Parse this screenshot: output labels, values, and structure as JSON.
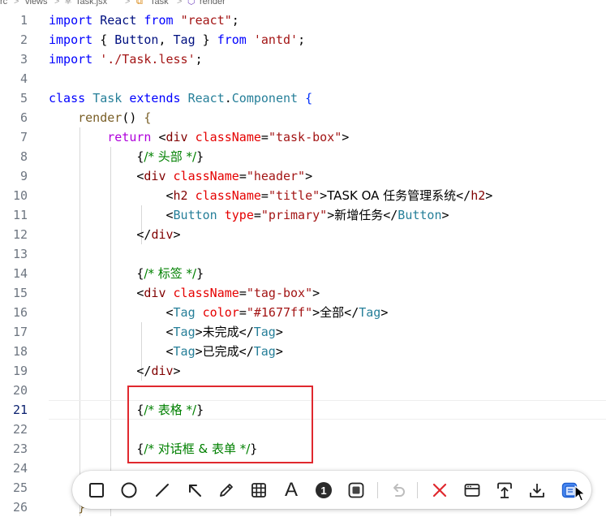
{
  "breadcrumb": {
    "segments": [
      "rc",
      "views",
      "Task.jsx",
      "Task",
      "render"
    ],
    "separator": ">"
  },
  "editor": {
    "current_line": 21,
    "line_numbers": [
      "1",
      "2",
      "3",
      "4",
      "5",
      "6",
      "7",
      "8",
      "9",
      "10",
      "11",
      "12",
      "13",
      "14",
      "15",
      "16",
      "17",
      "18",
      "19",
      "20",
      "21",
      "22",
      "23",
      "24",
      "25",
      "26"
    ],
    "lines": [
      [
        [
          "kw",
          "import"
        ],
        [
          "txt",
          " "
        ],
        [
          "var",
          "React"
        ],
        [
          "txt",
          " "
        ],
        [
          "kw",
          "from"
        ],
        [
          "txt",
          " "
        ],
        [
          "str",
          "\"react\""
        ],
        [
          "txt",
          ";"
        ]
      ],
      [
        [
          "kw",
          "import"
        ],
        [
          "txt",
          " { "
        ],
        [
          "var",
          "Button"
        ],
        [
          "txt",
          ", "
        ],
        [
          "var",
          "Tag"
        ],
        [
          "txt",
          " } "
        ],
        [
          "kw",
          "from"
        ],
        [
          "txt",
          " "
        ],
        [
          "str",
          "'antd'"
        ],
        [
          "txt",
          ";"
        ]
      ],
      [
        [
          "kw",
          "import"
        ],
        [
          "txt",
          " "
        ],
        [
          "str",
          "'./Task.less'"
        ],
        [
          "txt",
          ";"
        ]
      ],
      [],
      [
        [
          "kw",
          "class"
        ],
        [
          "txt",
          " "
        ],
        [
          "cls",
          "Task"
        ],
        [
          "txt",
          " "
        ],
        [
          "kw",
          "extends"
        ],
        [
          "txt",
          " "
        ],
        [
          "cls",
          "React"
        ],
        [
          "txt",
          "."
        ],
        [
          "cls",
          "Component"
        ],
        [
          "txt",
          " "
        ],
        [
          "br2",
          "{"
        ]
      ],
      [
        [
          "txt",
          "    "
        ],
        [
          "fn",
          "render"
        ],
        [
          "txt",
          "() "
        ],
        [
          "br",
          "{"
        ]
      ],
      [
        [
          "txt",
          "        "
        ],
        [
          "ctl",
          "return"
        ],
        [
          "txt",
          " <"
        ],
        [
          "tag",
          "div"
        ],
        [
          "txt",
          " "
        ],
        [
          "attr",
          "className"
        ],
        [
          "txt",
          "="
        ],
        [
          "str",
          "\"task-box\""
        ],
        [
          "txt",
          ">"
        ]
      ],
      [
        [
          "txt",
          "            "
        ],
        [
          "txt",
          "{"
        ],
        [
          "com",
          "/* 头部 */"
        ],
        [
          "txt",
          "}"
        ]
      ],
      [
        [
          "txt",
          "            <"
        ],
        [
          "tag",
          "div"
        ],
        [
          "txt",
          " "
        ],
        [
          "attr",
          "className"
        ],
        [
          "txt",
          "="
        ],
        [
          "str",
          "\"header\""
        ],
        [
          "txt",
          ">"
        ]
      ],
      [
        [
          "txt",
          "                <"
        ],
        [
          "tag",
          "h2"
        ],
        [
          "txt",
          " "
        ],
        [
          "attr",
          "className"
        ],
        [
          "txt",
          "="
        ],
        [
          "str",
          "\"title\""
        ],
        [
          "txt",
          ">"
        ],
        [
          "txt",
          "TASK OA 任务管理系统"
        ],
        [
          "txt",
          "</"
        ],
        [
          "tag",
          "h2"
        ],
        [
          "txt",
          ">"
        ]
      ],
      [
        [
          "txt",
          "                <"
        ],
        [
          "cls",
          "Button"
        ],
        [
          "txt",
          " "
        ],
        [
          "attr",
          "type"
        ],
        [
          "txt",
          "="
        ],
        [
          "str",
          "\"primary\""
        ],
        [
          "txt",
          ">"
        ],
        [
          "txt",
          "新增任务"
        ],
        [
          "txt",
          "</"
        ],
        [
          "cls",
          "Button"
        ],
        [
          "txt",
          ">"
        ]
      ],
      [
        [
          "txt",
          "            </"
        ],
        [
          "tag",
          "div"
        ],
        [
          "txt",
          ">"
        ]
      ],
      [],
      [
        [
          "txt",
          "            "
        ],
        [
          "txt",
          "{"
        ],
        [
          "com",
          "/* 标签 */"
        ],
        [
          "txt",
          "}"
        ]
      ],
      [
        [
          "txt",
          "            <"
        ],
        [
          "tag",
          "div"
        ],
        [
          "txt",
          " "
        ],
        [
          "attr",
          "className"
        ],
        [
          "txt",
          "="
        ],
        [
          "str",
          "\"tag-box\""
        ],
        [
          "txt",
          ">"
        ]
      ],
      [
        [
          "txt",
          "                <"
        ],
        [
          "cls",
          "Tag"
        ],
        [
          "txt",
          " "
        ],
        [
          "attr",
          "color"
        ],
        [
          "txt",
          "="
        ],
        [
          "str",
          "\"#1677ff\""
        ],
        [
          "txt",
          ">"
        ],
        [
          "txt",
          "全部"
        ],
        [
          "txt",
          "</"
        ],
        [
          "cls",
          "Tag"
        ],
        [
          "txt",
          ">"
        ]
      ],
      [
        [
          "txt",
          "                <"
        ],
        [
          "cls",
          "Tag"
        ],
        [
          "txt",
          ">"
        ],
        [
          "txt",
          "未完成"
        ],
        [
          "txt",
          "</"
        ],
        [
          "cls",
          "Tag"
        ],
        [
          "txt",
          ">"
        ]
      ],
      [
        [
          "txt",
          "                <"
        ],
        [
          "cls",
          "Tag"
        ],
        [
          "txt",
          ">"
        ],
        [
          "txt",
          "已完成"
        ],
        [
          "txt",
          "</"
        ],
        [
          "cls",
          "Tag"
        ],
        [
          "txt",
          ">"
        ]
      ],
      [
        [
          "txt",
          "            </"
        ],
        [
          "tag",
          "div"
        ],
        [
          "txt",
          ">"
        ]
      ],
      [],
      [
        [
          "txt",
          "            "
        ],
        [
          "txt",
          "{"
        ],
        [
          "com",
          "/* 表格 */"
        ],
        [
          "txt",
          "}"
        ]
      ],
      [],
      [
        [
          "txt",
          "            "
        ],
        [
          "txt",
          "{"
        ],
        [
          "com",
          "/* 对话框 & 表单 */"
        ],
        [
          "txt",
          "}"
        ]
      ],
      [],
      [],
      [
        [
          "txt",
          "    "
        ],
        [
          "br",
          "}"
        ]
      ]
    ]
  },
  "toolbar": {
    "tools": [
      {
        "name": "rectangle-tool",
        "icon": "square-icon"
      },
      {
        "name": "ellipse-tool",
        "icon": "circle-icon"
      },
      {
        "name": "line-tool",
        "icon": "line-icon"
      },
      {
        "name": "arrow-tool",
        "icon": "arrow-icon"
      },
      {
        "name": "pen-tool",
        "icon": "pencil-icon"
      },
      {
        "name": "mosaic-tool",
        "icon": "grid-icon"
      },
      {
        "name": "text-tool",
        "icon": "text-icon"
      },
      {
        "name": "counter-tool",
        "icon": "number-badge-icon"
      },
      {
        "name": "highlight-tool",
        "icon": "frame-icon"
      },
      {
        "name": "undo-button",
        "icon": "undo-icon"
      },
      {
        "name": "cancel-button",
        "icon": "close-icon"
      },
      {
        "name": "window-button",
        "icon": "window-icon"
      },
      {
        "name": "pin-button",
        "icon": "pin-icon"
      },
      {
        "name": "save-button",
        "icon": "download-icon"
      },
      {
        "name": "copy-button",
        "icon": "clipboard-icon"
      }
    ],
    "counter_label": "1",
    "text_label": "A",
    "colors": {
      "accent": "#4a8af4",
      "cancel": "#e0282e",
      "annotation": "#e0282e"
    }
  }
}
